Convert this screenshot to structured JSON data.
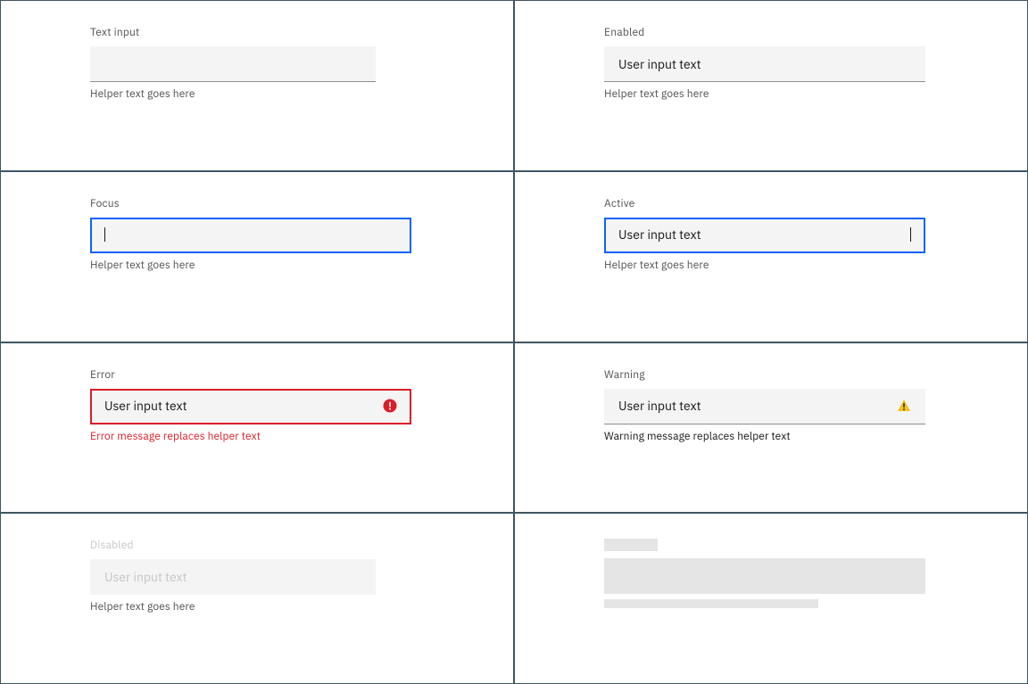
{
  "row1": {
    "left": {
      "label": "Text input",
      "value": "",
      "helper": "Helper text goes here"
    },
    "right": {
      "label": "Enabled",
      "value": "User input text",
      "helper": "Helper text goes here"
    }
  },
  "row2": {
    "left": {
      "label": "Focus",
      "value": "",
      "helper": "Helper text goes here"
    },
    "right": {
      "label": "Active",
      "value": "User input text",
      "helper": "Helper text goes here"
    }
  },
  "row3": {
    "left": {
      "label": "Error",
      "value": "User input text",
      "helper": "Error message replaces helper text"
    },
    "right": {
      "label": "Warning",
      "value": "User input text",
      "helper": "Warning message replaces helper text"
    }
  },
  "row4": {
    "left": {
      "label": "Disabled",
      "value": "User input text",
      "helper": "Helper text goes here"
    }
  },
  "colors": {
    "focus": "#0f62fe",
    "error": "#da1e28",
    "warning": "#f1c21b",
    "text": "#161616",
    "helper": "#525252",
    "field": "#f4f4f4"
  }
}
